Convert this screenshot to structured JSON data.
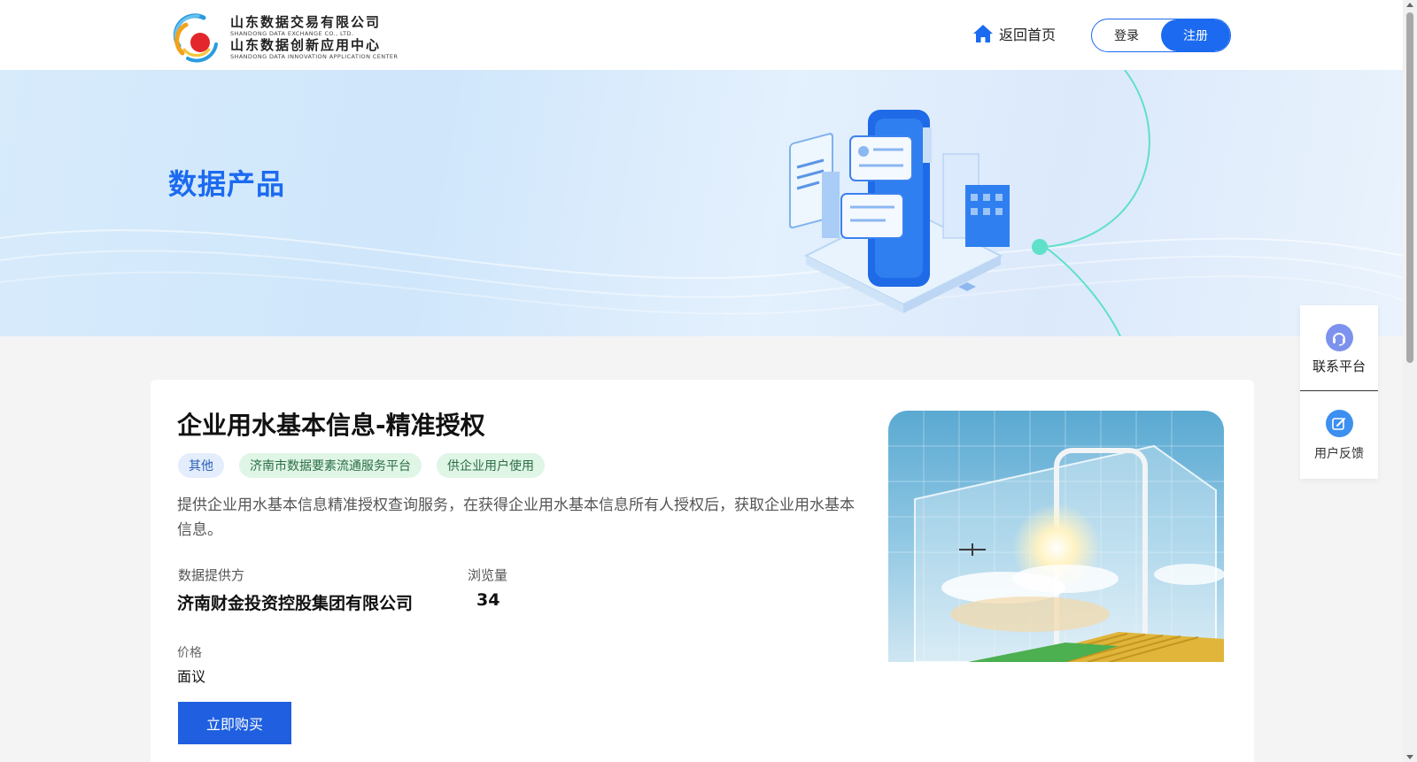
{
  "header": {
    "logo": {
      "cn_line1": "山东数据交易有限公司",
      "en_line1": "SHANDONG DATA EXCHANGE CO., LTD.",
      "cn_line2": "山东数据创新应用中心",
      "en_line2": "SHANDONG DATA INNOVATION APPLICATION CENTER"
    },
    "home_link": "返回首页",
    "login_label": "登录",
    "register_label": "注册"
  },
  "banner": {
    "title": "数据产品"
  },
  "product": {
    "title": "企业用水基本信息-精准授权",
    "tags": [
      {
        "label": "其他",
        "style": "blue"
      },
      {
        "label": "济南市数据要素流通服务平台",
        "style": "green"
      },
      {
        "label": "供企业用户使用",
        "style": "green"
      }
    ],
    "description": "提供企业用水基本信息精准授权查询服务，在获得企业用水基本信息所有人授权后，获取企业用水基本信息。",
    "provider_label": "数据提供方",
    "provider_value": "济南财金投资控股集团有限公司",
    "views_label": "浏览量",
    "views_value": "34",
    "price_label": "价格",
    "price_value": "面议",
    "buy_button": "立即购买"
  },
  "side_panel": {
    "contact_label": "联系平台",
    "feedback_label": "用户反馈"
  },
  "colors": {
    "primary": "#1b6af0",
    "buy_button": "#1f5fe0",
    "tag_blue_bg": "#e4edfb",
    "tag_green_bg": "#dff5e6",
    "page_bg": "#f4f4f5"
  },
  "icons": {
    "home": "home-icon",
    "contact": "headset-icon",
    "feedback": "edit-icon"
  }
}
